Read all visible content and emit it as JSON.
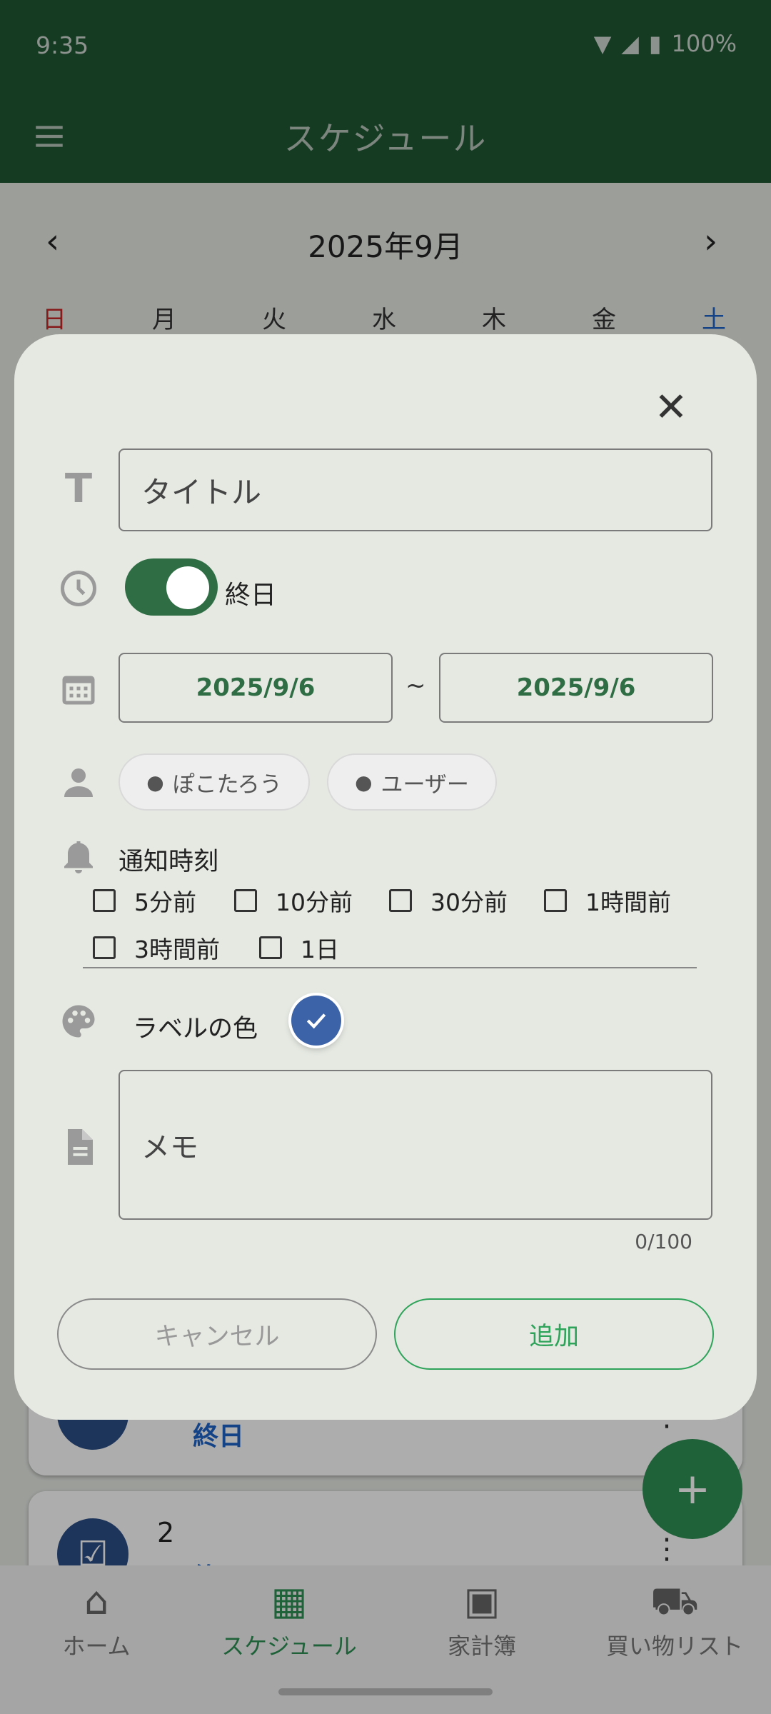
{
  "status_bar": {
    "time": "9:35",
    "battery": "100%"
  },
  "app_bar": {
    "title": "スケジュール"
  },
  "calendar": {
    "month": "2025年9月",
    "weekdays": [
      "日",
      "月",
      "火",
      "水",
      "木",
      "金",
      "土"
    ]
  },
  "background_list": {
    "item1": {
      "subtitle": "終日"
    },
    "item2": {
      "title": "2",
      "subtitle": "終日"
    }
  },
  "dialog": {
    "title_placeholder": "タイトル",
    "all_day": {
      "label": "終日",
      "on": true
    },
    "date_start": "2025/9/6",
    "date_separator": "~",
    "date_end": "2025/9/6",
    "members": [
      "ぽこたろう",
      "ユーザー"
    ],
    "notify": {
      "label": "通知時刻",
      "options": [
        "5分前",
        "10分前",
        "30分前",
        "1時間前",
        "3時間前",
        "1日"
      ]
    },
    "label_color": {
      "label": "ラベルの色",
      "color": "#3c63a8"
    },
    "memo_placeholder": "メモ",
    "memo_counter": "0/100",
    "cancel_label": "キャンセル",
    "add_label": "追加"
  },
  "bottom_nav": {
    "items": [
      {
        "label": "ホーム"
      },
      {
        "label": "スケジュール"
      },
      {
        "label": "家計簿"
      },
      {
        "label": "買い物リスト"
      }
    ]
  }
}
